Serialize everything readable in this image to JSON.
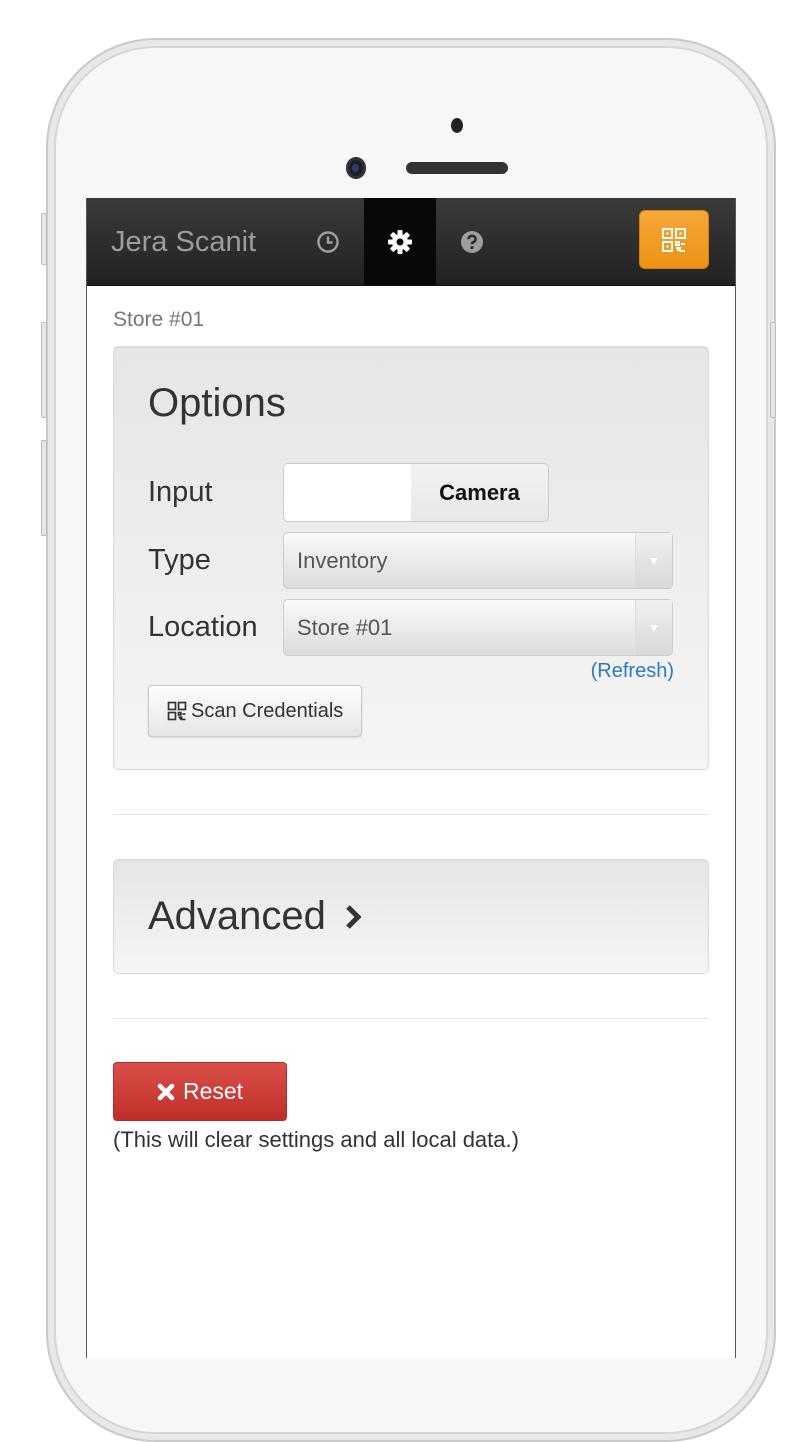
{
  "navbar": {
    "brand": "Jera Scanit",
    "items": [
      {
        "name": "history",
        "icon": "clock-icon",
        "active": false
      },
      {
        "name": "settings",
        "icon": "gear-icon",
        "active": true
      },
      {
        "name": "help",
        "icon": "question-circle-icon",
        "active": false
      }
    ],
    "scan_button_icon": "qr-code-icon"
  },
  "store_label": "Store #01",
  "options": {
    "title": "Options",
    "input": {
      "label": "Input",
      "value": "Camera"
    },
    "type": {
      "label": "Type",
      "value": "Inventory"
    },
    "location": {
      "label": "Location",
      "value": "Store #01"
    },
    "refresh_label": "(Refresh)",
    "scan_credentials_label": "Scan Credentials"
  },
  "advanced": {
    "title": "Advanced"
  },
  "reset": {
    "label": "Reset",
    "note": "(This will clear settings and all local data.)"
  },
  "colors": {
    "accent": "#ee9213",
    "danger": "#c12e2a",
    "link": "#2a7ac0",
    "navbar": "#222222"
  }
}
